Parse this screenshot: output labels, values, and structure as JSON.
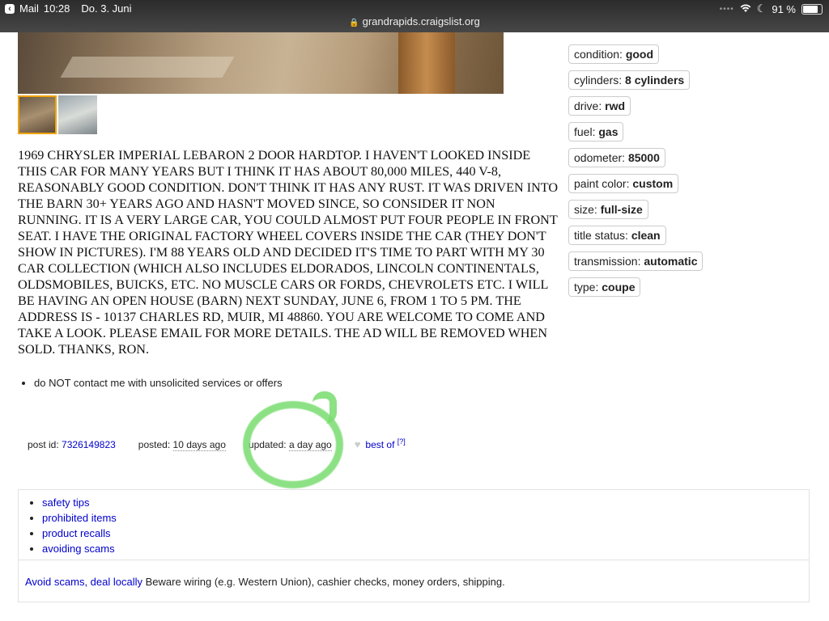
{
  "status_bar": {
    "back_app": "Mail",
    "time": "10:28",
    "date": "Do. 3. Juni",
    "battery": "91 %",
    "battery_level": 0.91
  },
  "url_bar": {
    "url": "grandrapids.craigslist.org"
  },
  "description": "1969 CHRYSLER IMPERIAL LEBARON 2 DOOR HARDTOP. I HAVEN'T LOOKED INSIDE THIS CAR FOR MANY YEARS BUT I THINK IT HAS ABOUT 80,000 MILES, 440 V-8, REASONABLY GOOD CONDITION. DON'T THINK IT HAS ANY RUST. IT WAS DRIVEN INTO THE BARN 30+ YEARS AGO AND HASN'T MOVED SINCE, SO CONSIDER IT NON RUNNING. IT IS A VERY LARGE CAR, YOU COULD ALMOST PUT FOUR PEOPLE IN FRONT SEAT. I HAVE THE ORIGINAL FACTORY WHEEL COVERS INSIDE THE CAR (THEY DON'T SHOW IN PICTURES). I'M 88 YEARS OLD AND DECIDED IT'S TIME TO PART WITH MY 30 CAR COLLECTION (WHICH ALSO INCLUDES ELDORADOS, LINCOLN CONTINENTALS, OLDSMOBILES, BUICKS, ETC. NO MUSCLE CARS OR FORDS, CHEVROLETS ETC. I WILL BE HAVING AN OPEN HOUSE (BARN) NEXT SUNDAY, JUNE 6, FROM 1 TO 5 PM. THE ADDRESS IS - 10137 CHARLES RD, MUIR, MI 48860. YOU ARE WELCOME TO COME AND TAKE A LOOK. PLEASE EMAIL FOR MORE DETAILS. THE AD WILL BE REMOVED WHEN SOLD. THANKS, RON.",
  "notices": [
    "do NOT contact me with unsolicited services or offers"
  ],
  "post_info": {
    "post_id_label": "post id:",
    "post_id": "7326149823",
    "posted_label": "posted:",
    "posted": "10 days ago",
    "updated_label": "updated:",
    "updated": "a day ago",
    "best_of": "best of",
    "best_of_help": "[?]"
  },
  "attributes": [
    {
      "key": "condition:",
      "value": "good"
    },
    {
      "key": "cylinders:",
      "value": "8 cylinders"
    },
    {
      "key": "drive:",
      "value": "rwd"
    },
    {
      "key": "fuel:",
      "value": "gas"
    },
    {
      "key": "odometer:",
      "value": "85000"
    },
    {
      "key": "paint color:",
      "value": "custom"
    },
    {
      "key": "size:",
      "value": "full-size"
    },
    {
      "key": "title status:",
      "value": "clean"
    },
    {
      "key": "transmission:",
      "value": "automatic"
    },
    {
      "key": "type:",
      "value": "coupe"
    }
  ],
  "safety": {
    "links": [
      "safety tips",
      "prohibited items",
      "product recalls",
      "avoiding scams"
    ],
    "warning_link": "Avoid scams, deal locally",
    "warning_text": " Beware wiring (e.g. Western Union), cashier checks, money orders, shipping."
  },
  "colors": {
    "link": "#0000cc",
    "thumb_selected_border": "#f0a30a",
    "annotation_circle": "#78dc6e"
  }
}
